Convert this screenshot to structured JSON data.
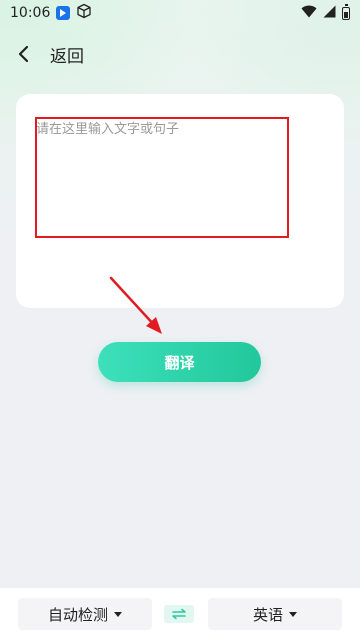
{
  "status_bar": {
    "time": "10:06"
  },
  "header": {
    "back_label": "返回"
  },
  "input": {
    "placeholder": "请在这里输入文字或句子",
    "value": ""
  },
  "translate_button": {
    "label": "翻译"
  },
  "language_bar": {
    "source_language": "自动检测",
    "target_language": "英语"
  },
  "colors": {
    "accent_start": "#3de0bb",
    "accent_end": "#22c79b",
    "annotation_red": "#e21a22"
  },
  "icons": [
    "app-notification-icon",
    "cube-icon",
    "wifi-icon",
    "signal-icon",
    "battery-icon",
    "back-icon",
    "swap-icon",
    "caret-down-icon"
  ]
}
